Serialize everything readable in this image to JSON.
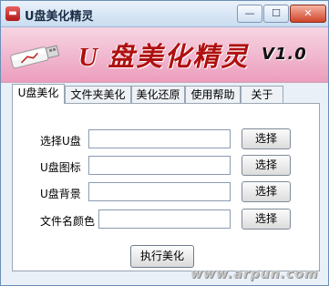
{
  "window": {
    "title": "U盘美化精灵",
    "minimize_label": "—",
    "maximize_label": "☐",
    "close_label": "✕"
  },
  "banner": {
    "title": "U 盘美化精灵",
    "version": "V1.0"
  },
  "tabs": [
    {
      "label": "U盘美化",
      "active": true
    },
    {
      "label": "文件夹美化",
      "active": false
    },
    {
      "label": "美化还原",
      "active": false
    },
    {
      "label": "使用帮助",
      "active": false
    },
    {
      "label": "关于",
      "active": false
    }
  ],
  "form": {
    "rows": [
      {
        "label": "选择U盘",
        "value": "",
        "button": "选择"
      },
      {
        "label": "U盘图标",
        "value": "",
        "button": "选择"
      },
      {
        "label": "U盘背景",
        "value": "",
        "button": "选择"
      },
      {
        "label": "文件名颜色",
        "value": "",
        "button": "选择"
      }
    ],
    "run_button": "执行美化"
  },
  "watermark": "www.arpun.com"
}
